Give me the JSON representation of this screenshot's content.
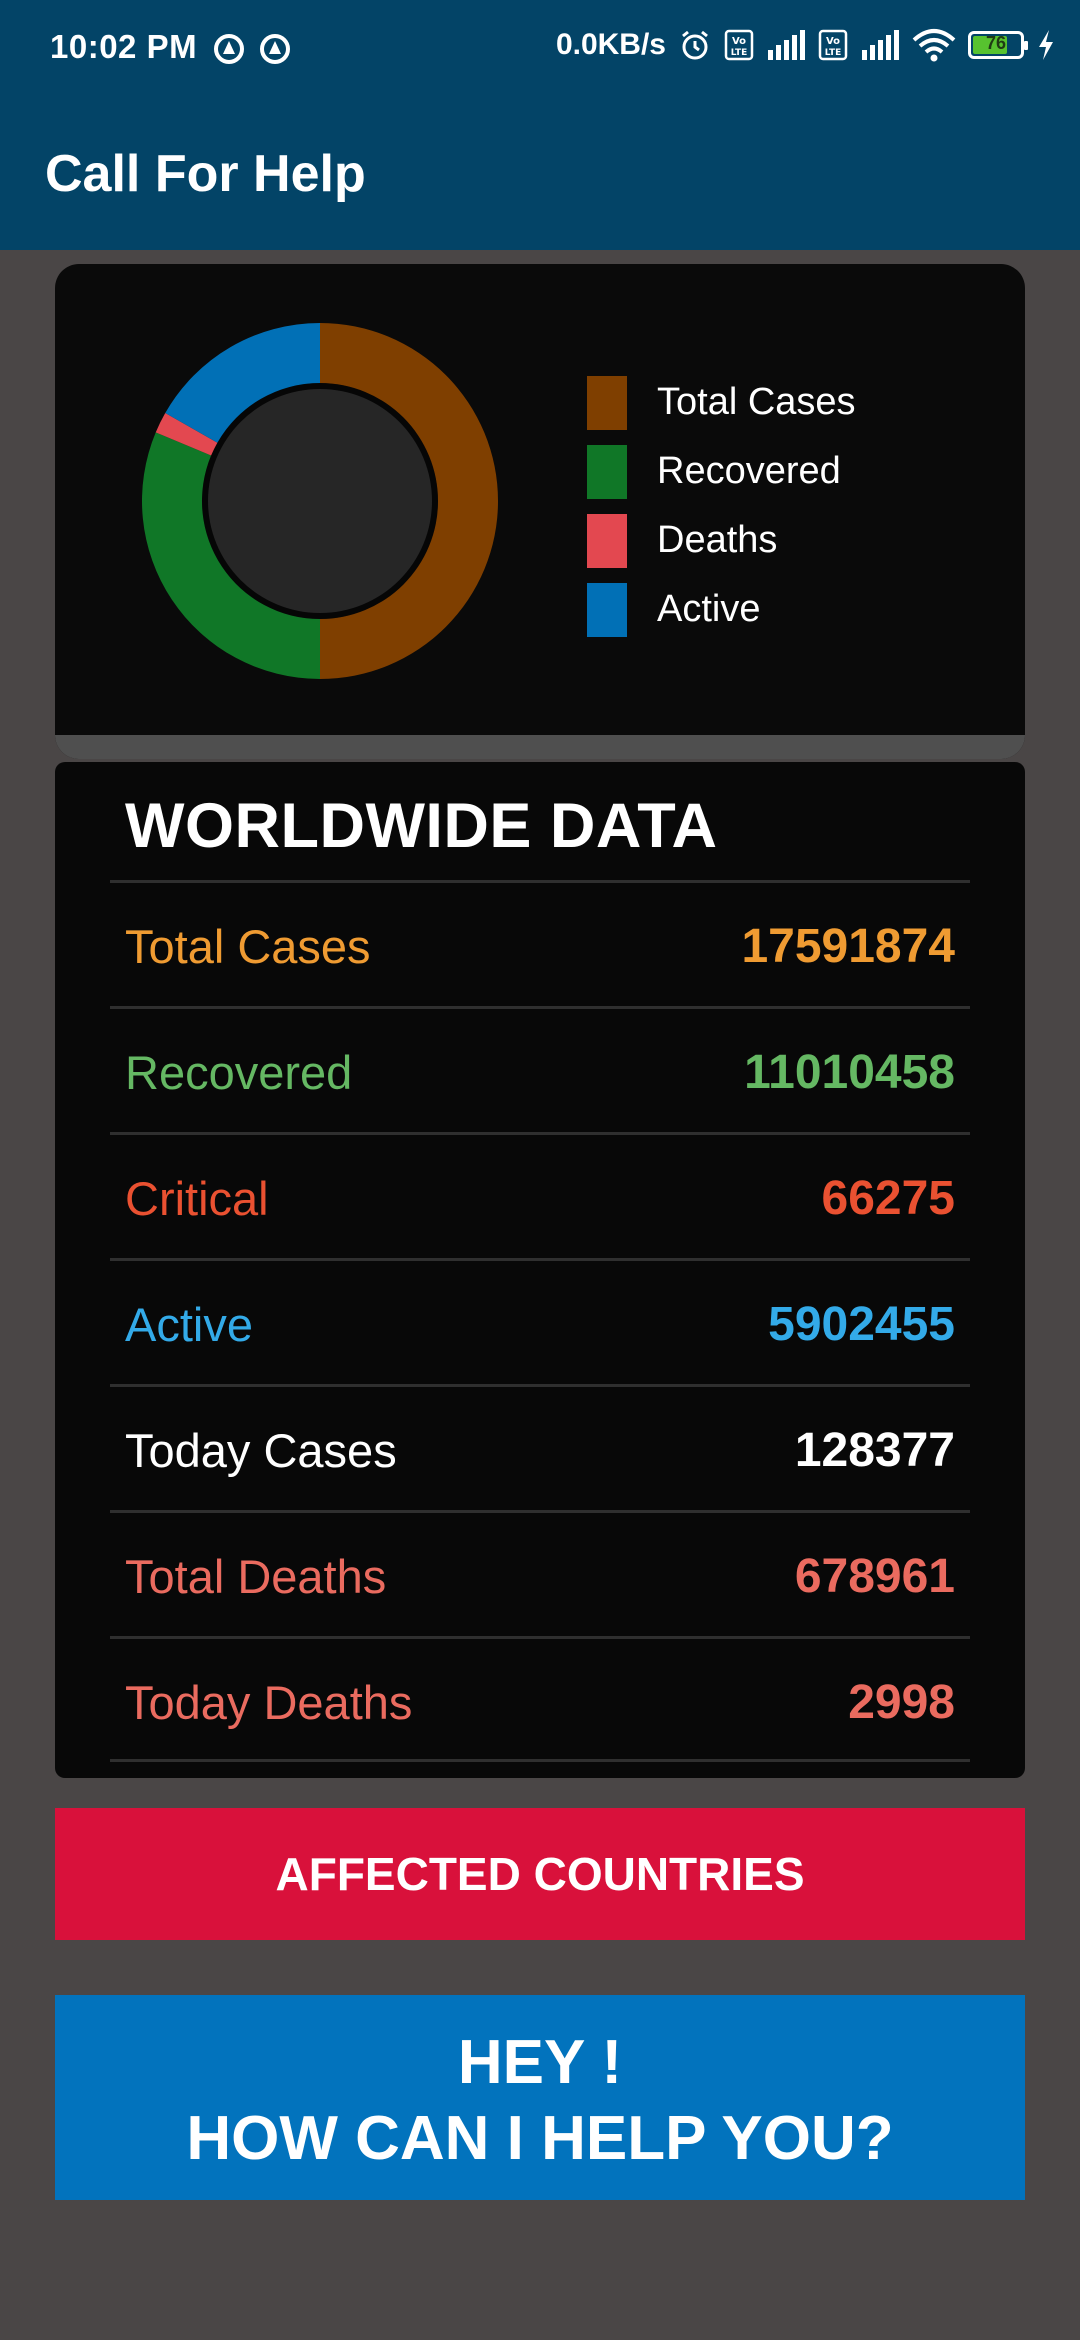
{
  "status_bar": {
    "time": "10:02 PM",
    "net_speed": "0.0KB/s",
    "battery": "76",
    "battery_level": 0.76,
    "icons": [
      "vpn-icon",
      "vpn-icon",
      "alarm-icon",
      "volte-icon",
      "signal-icon",
      "volte-icon",
      "signal-icon",
      "wifi-icon",
      "battery-icon",
      "charging-icon"
    ]
  },
  "app_bar": {
    "title": "Call For Help"
  },
  "chart_data": {
    "type": "pie",
    "style": "donut",
    "categories": [
      "Total Cases",
      "Recovered",
      "Deaths",
      "Active"
    ],
    "values": [
      17591874,
      11010458,
      678961,
      5902455
    ],
    "colors": [
      "#7f3f00",
      "#107727",
      "#e34850",
      "#0170b6"
    ],
    "legend": "right"
  },
  "worldwide": {
    "title": "WORLDWIDE DATA",
    "rows": [
      {
        "label": "Total Cases",
        "value": "17591874",
        "color": "#ef9b32"
      },
      {
        "label": "Recovered",
        "value": "11010458",
        "color": "#65b863"
      },
      {
        "label": "Critical",
        "value": "66275",
        "color": "#ea5131"
      },
      {
        "label": "Active",
        "value": "5902455",
        "color": "#33aae8"
      },
      {
        "label": "Today Cases",
        "value": "128377",
        "color": "#ffffff"
      },
      {
        "label": "Total Deaths",
        "value": "678961",
        "color": "#ea6b5f"
      },
      {
        "label": "Today Deaths",
        "value": "2998",
        "color": "#ea6b5f"
      }
    ]
  },
  "buttons": {
    "affected": "AFFECTED COUNTRIES",
    "help_line1": "HEY !",
    "help_line2": "HOW CAN I HELP YOU?"
  },
  "colors": {
    "app_bar": "#034467",
    "background": "#4a4646",
    "affected_button": "#d9113b",
    "help_button": "#0273bd"
  }
}
